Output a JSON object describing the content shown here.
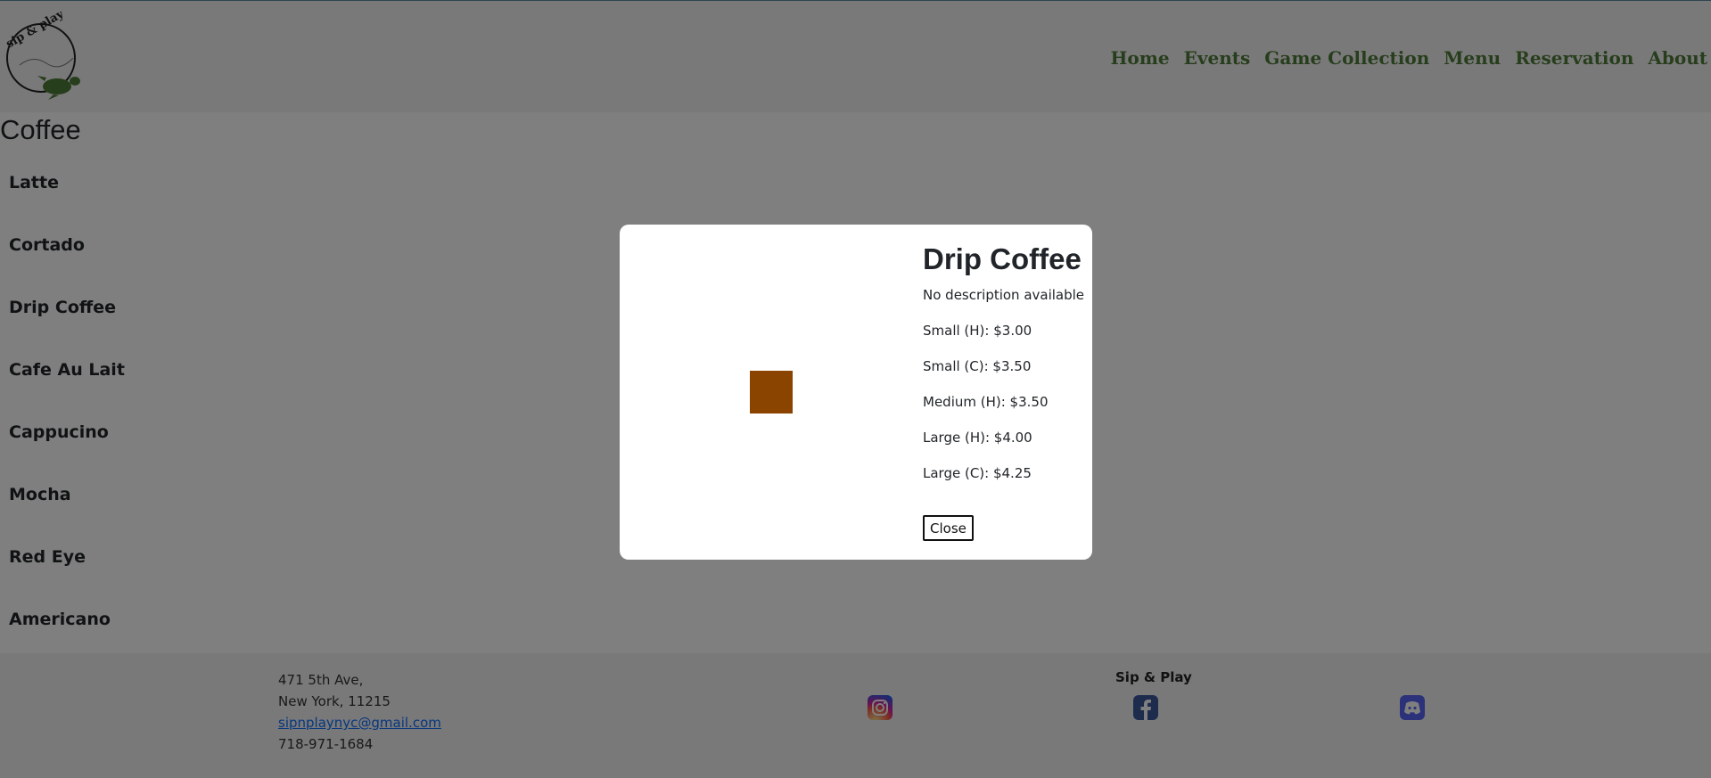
{
  "brand": {
    "logo_text": "sip & play"
  },
  "nav": [
    "Home",
    "Events",
    "Game Collection",
    "Menu",
    "Reservation",
    "About"
  ],
  "section": {
    "title": "Coffee"
  },
  "menu_items": [
    "Latte",
    "Cortado",
    "Drip Coffee",
    "Cafe Au Lait",
    "Cappucino",
    "Mocha",
    "Red Eye",
    "Americano"
  ],
  "modal": {
    "title": "Drip Coffee",
    "description": "No description available",
    "swatch_color": "#8b4400",
    "prices": [
      "Small (H): $3.00",
      "Small (C): $3.50",
      "Medium (H): $3.50",
      "Large (H): $4.00",
      "Large (C): $4.25"
    ],
    "close_label": "Close"
  },
  "footer": {
    "address_line1": "471 5th Ave,",
    "address_line2": "New York, 11215",
    "email": "sipnplaynyc@gmail.com",
    "phone": "718-971-1684",
    "brand": "Sip & Play",
    "social_icons": [
      "instagram-icon",
      "facebook-icon",
      "discord-icon"
    ]
  },
  "colors": {
    "nav_green": "#4f7d39",
    "overlay": "rgba(0,0,0,0.5)"
  }
}
